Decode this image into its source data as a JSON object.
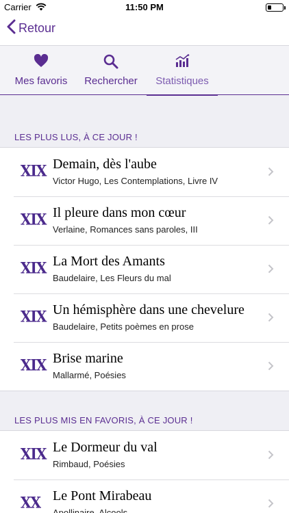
{
  "status": {
    "carrier": "Carrier",
    "time": "11:50 PM"
  },
  "nav": {
    "back_label": "Retour"
  },
  "tabs": [
    {
      "label": "Mes favoris",
      "icon": "heart-icon"
    },
    {
      "label": "Rechercher",
      "icon": "search-icon"
    },
    {
      "label": "Statistiques",
      "icon": "stats-icon",
      "active": true
    }
  ],
  "sections": [
    {
      "header": "LES PLUS LUS, À CE JOUR !",
      "items": [
        {
          "century": "XIX",
          "title": "Demain, dès l'aube",
          "subtitle": "Victor Hugo, Les Contemplations, Livre IV"
        },
        {
          "century": "XIX",
          "title": "Il pleure dans mon cœur",
          "subtitle": "Verlaine, Romances sans paroles, III"
        },
        {
          "century": "XIX",
          "title": "La Mort des Amants",
          "subtitle": "Baudelaire, Les Fleurs du mal"
        },
        {
          "century": "XIX",
          "title": "Un hémisphère dans une chevelure",
          "subtitle": "Baudelaire, Petits poèmes en prose"
        },
        {
          "century": "XIX",
          "title": "Brise marine",
          "subtitle": "Mallarmé, Poésies"
        }
      ]
    },
    {
      "header": "LES PLUS MIS EN FAVORIS, À CE JOUR !",
      "items": [
        {
          "century": "XIX",
          "title": "Le Dormeur du val",
          "subtitle": "Rimbaud, Poésies"
        },
        {
          "century": "XX",
          "title": "Le Pont Mirabeau",
          "subtitle": "Apollinaire, Alcools"
        }
      ]
    }
  ],
  "colors": {
    "accent": "#5a2d91",
    "century": "#4b2a8c",
    "background": "#efeff4"
  }
}
